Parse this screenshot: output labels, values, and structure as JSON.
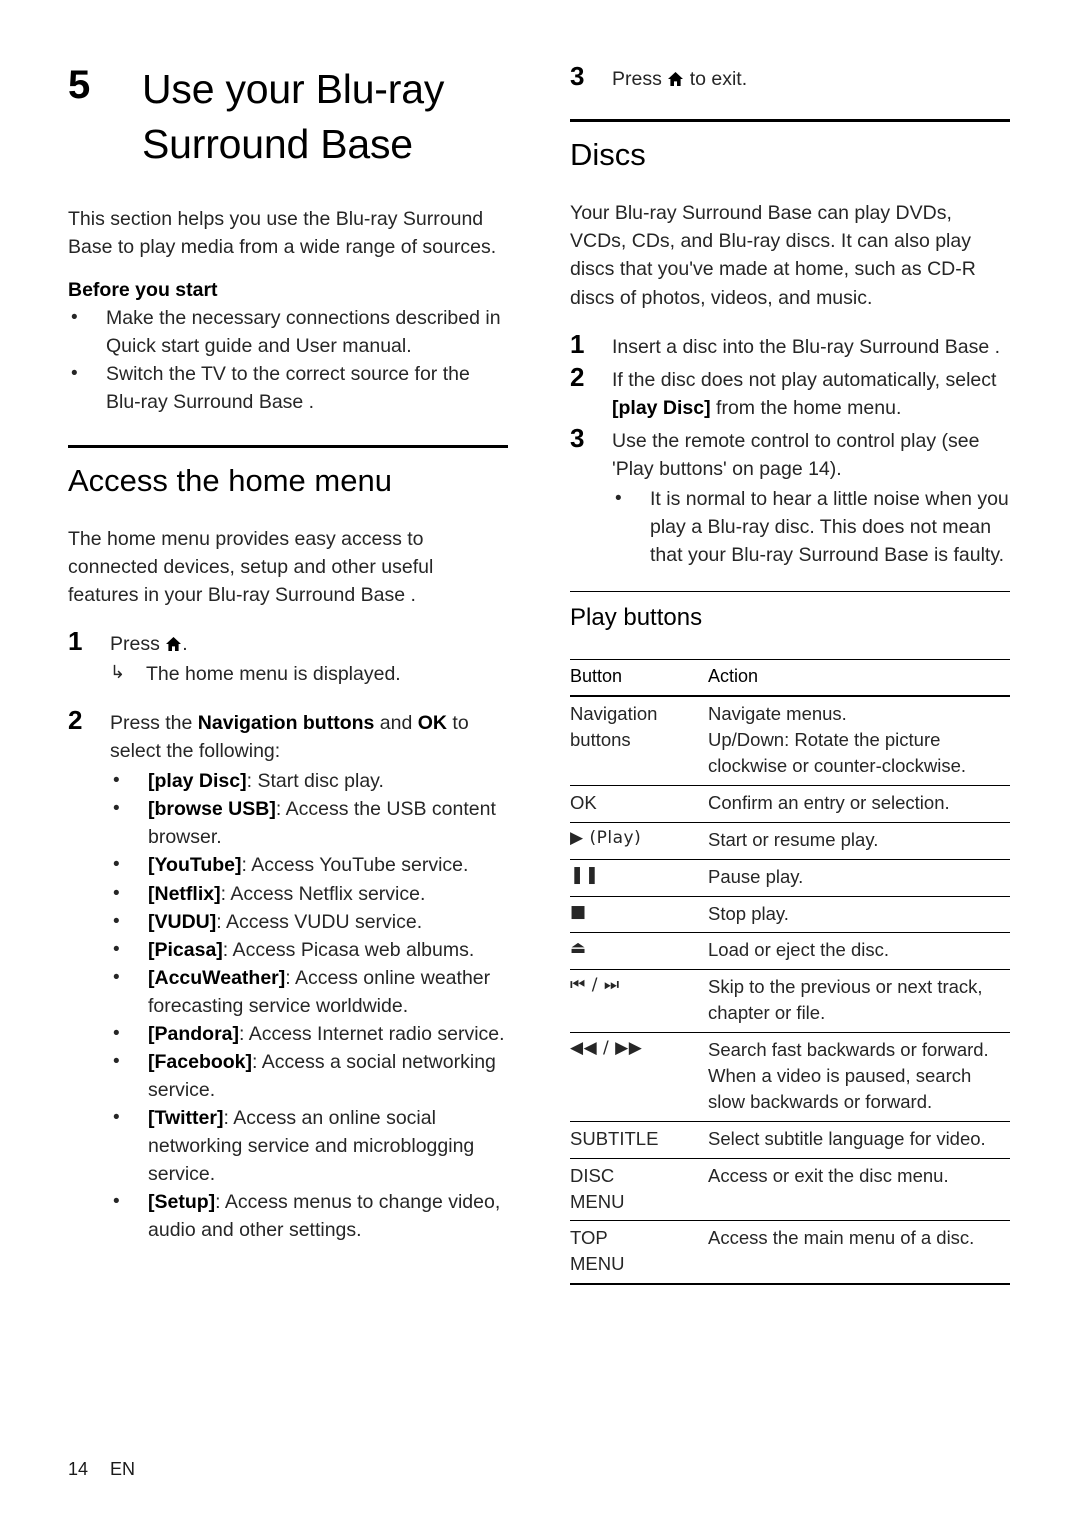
{
  "chapter": {
    "number": "5",
    "title": "Use your Blu-ray Surround Base"
  },
  "intro": {
    "paragraph": "This section helps you use the Blu-ray Surround Base  to play media from a wide range of sources.",
    "before_you_start_label": "Before you start",
    "before_you_start_items": [
      "Make the necessary connections described in Quick start guide and User manual.",
      "Switch the TV to the correct source for the Blu-ray Surround Base ."
    ]
  },
  "home_menu": {
    "heading": "Access the home menu",
    "intro": "The home menu provides easy access to connected devices, setup and other useful features in your Blu-ray Surround Base .",
    "step1_num": "1",
    "step1_pre": "Press",
    "step1_post": ".",
    "step1_result_arrow": "↳",
    "step1_result": "The home menu is displayed.",
    "step2_num": "2",
    "step2_pre": "Press the ",
    "step2_bold1": "Navigation buttons",
    "step2_mid": " and ",
    "step2_bold2": "OK",
    "step2_post": " to select the following:",
    "options": [
      {
        "term": "[play Disc]",
        "desc": ": Start disc play."
      },
      {
        "term": "[browse USB]",
        "desc": ": Access the USB content browser."
      },
      {
        "term": "[YouTube]",
        "desc": ": Access YouTube service."
      },
      {
        "term": "[Netflix]",
        "desc": ": Access Netflix service."
      },
      {
        "term": "[VUDU]",
        "desc": ": Access VUDU service."
      },
      {
        "term": "[Picasa]",
        "desc": ": Access Picasa web albums."
      },
      {
        "term": "[AccuWeather]",
        "desc": ": Access online weather forecasting service worldwide."
      },
      {
        "term": "[Pandora]",
        "desc": ": Access Internet radio service."
      },
      {
        "term": "[Facebook]",
        "desc": ": Access a social networking service."
      },
      {
        "term": "[Twitter]",
        "desc": ": Access an online social networking service and microblogging service."
      },
      {
        "term": "[Setup]",
        "desc": ": Access menus to change video, audio and other settings."
      }
    ],
    "step3_num": "3",
    "step3_pre": "Press",
    "step3_post": "to exit."
  },
  "discs": {
    "heading": "Discs",
    "intro": "Your Blu-ray Surround Base  can play DVDs, VCDs, CDs, and Blu-ray discs. It can also play discs that you've made at home, such as CD-R discs of photos, videos, and music.",
    "step1_num": "1",
    "step1_text": "Insert a disc into the Blu-ray Surround Base .",
    "step2_num": "2",
    "step2_pre": "If the disc does not play automatically, select ",
    "step2_bold": "[play Disc]",
    "step2_post": " from the home menu.",
    "step3_num": "3",
    "step3_text": "Use the remote control to control play (see 'Play buttons' on page 14).",
    "step3_bullet": "It is normal to hear a little noise when you play a Blu-ray disc. This does not mean that your Blu-ray Surround Base is faulty."
  },
  "play_buttons": {
    "heading": "Play buttons",
    "columns": [
      "Button",
      "Action"
    ],
    "rows": [
      {
        "button": "Navigation buttons",
        "button_bold": true,
        "glyph": false,
        "action": "Navigate menus.\nUp/Down: Rotate the picture clockwise or counter-clockwise."
      },
      {
        "button": "OK",
        "button_bold": false,
        "glyph": false,
        "action": "Confirm an entry or selection."
      },
      {
        "button": "▶ (Play)",
        "button_bold": false,
        "glyph": true,
        "icon_name": "play-icon",
        "action": "Start or resume play."
      },
      {
        "button": "❚❚",
        "button_bold": false,
        "glyph": true,
        "icon_name": "pause-icon",
        "action": "Pause play."
      },
      {
        "button": "■",
        "button_bold": false,
        "glyph": true,
        "icon_name": "stop-icon",
        "action": "Stop play."
      },
      {
        "button": "⏏",
        "button_bold": false,
        "glyph": true,
        "icon_name": "eject-icon",
        "action": "Load or eject the disc."
      },
      {
        "button": "⏮ / ⏭",
        "button_bold": false,
        "glyph": true,
        "icon_name": "skip-icon",
        "action": "Skip to the previous or next track, chapter or file."
      },
      {
        "button": "◀◀ / ▶▶",
        "button_bold": false,
        "glyph": true,
        "icon_name": "search-fast-icon",
        "action": "Search fast backwards or forward. When a video is paused, search slow backwards or forward."
      },
      {
        "button": "SUBTITLE",
        "button_bold": false,
        "glyph": false,
        "action": "Select subtitle language for video."
      },
      {
        "button": "DISC MENU",
        "button_bold": false,
        "glyph": false,
        "action": "Access or exit the disc menu."
      },
      {
        "button": "TOP MENU",
        "button_bold": false,
        "glyph": false,
        "action": "Access the main menu of a disc."
      }
    ]
  },
  "footer": {
    "page_number": "14",
    "language": "EN"
  }
}
